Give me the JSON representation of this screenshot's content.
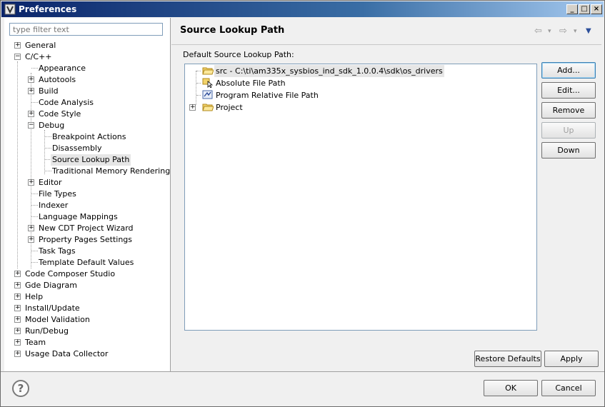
{
  "window": {
    "title": "Preferences",
    "controls": {
      "minimize": "_",
      "maximize": "□",
      "close": "×"
    }
  },
  "filter": {
    "placeholder": "type filter text",
    "value": ""
  },
  "tree": {
    "general": "General",
    "cpp": "C/C++",
    "appearance": "Appearance",
    "autotools": "Autotools",
    "build": "Build",
    "code_analysis": "Code Analysis",
    "code_style": "Code Style",
    "debug": "Debug",
    "breakpoint_actions": "Breakpoint Actions",
    "disassembly": "Disassembly",
    "source_lookup_path": "Source Lookup Path",
    "traditional_memory_rendering": "Traditional Memory Rendering",
    "editor": "Editor",
    "file_types": "File Types",
    "indexer": "Indexer",
    "language_mappings": "Language Mappings",
    "new_cdt_project_wizard": "New CDT Project Wizard",
    "property_pages_settings": "Property Pages Settings",
    "task_tags": "Task Tags",
    "template_default_values": "Template Default Values",
    "code_composer_studio": "Code Composer Studio",
    "gde_diagram": "Gde Diagram",
    "help": "Help",
    "install_update": "Install/Update",
    "model_validation": "Model Validation",
    "run_debug": "Run/Debug",
    "team": "Team",
    "usage_data_collector": "Usage Data Collector",
    "plus": "+",
    "minus": "−"
  },
  "page": {
    "title": "Source Lookup Path",
    "section_label": "Default Source Lookup Path:",
    "entries": {
      "src": "src - C:\\ti\\am335x_sysbios_ind_sdk_1.0.0.4\\sdk\\os_drivers",
      "absolute": "Absolute File Path",
      "program_relative": "Program Relative File Path",
      "project": "Project"
    },
    "buttons": {
      "add": "Add...",
      "edit": "Edit...",
      "remove": "Remove",
      "up": "Up",
      "down": "Down",
      "restore_defaults": "Restore Defaults",
      "apply": "Apply"
    }
  },
  "dialog": {
    "help": "?",
    "ok": "OK",
    "cancel": "Cancel"
  },
  "nav": {
    "back": "⇦",
    "forward": "⇨",
    "dropdown": "▾",
    "menu": "▼"
  },
  "colors": {
    "title_start": "#0a246a",
    "title_end": "#a6caf0",
    "selection": "#e6e6e6"
  }
}
